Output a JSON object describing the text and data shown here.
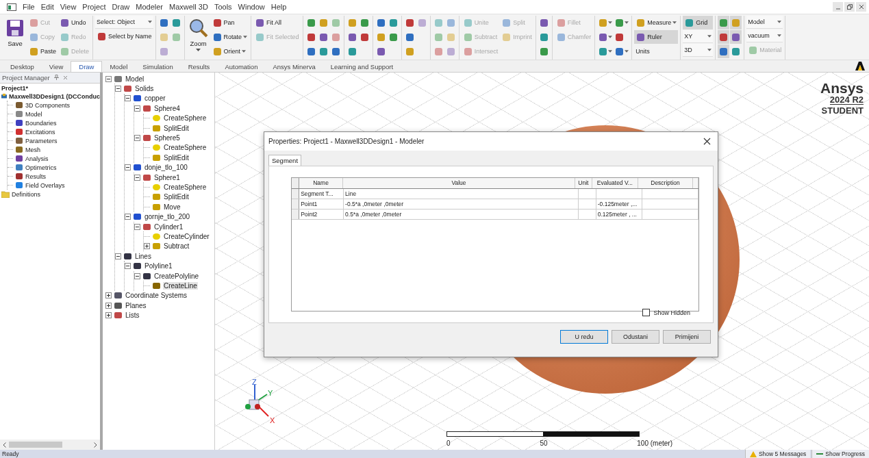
{
  "menu": [
    "File",
    "Edit",
    "View",
    "Project",
    "Draw",
    "Modeler",
    "Maxwell 3D",
    "Tools",
    "Window",
    "Help"
  ],
  "ribbon": {
    "groups": [
      {
        "columns": [
          [
            {
              "kind": "large",
              "label": "Save",
              "disabled": false
            }
          ],
          [
            {
              "kind": "small",
              "label": "Cut",
              "disabled": true
            },
            {
              "kind": "small",
              "label": "Copy",
              "disabled": true
            },
            {
              "kind": "small",
              "label": "Paste",
              "disabled": false
            }
          ],
          [
            {
              "kind": "small",
              "label": "Undo",
              "disabled": false
            },
            {
              "kind": "small",
              "label": "Redo",
              "disabled": true
            },
            {
              "kind": "small",
              "label": "Delete",
              "disabled": true
            }
          ]
        ]
      },
      {
        "columns": [
          [
            {
              "kind": "select",
              "label": "Select: Object"
            },
            {
              "kind": "small",
              "label": "Select by Name",
              "disabled": false
            }
          ]
        ]
      },
      {
        "columns": [
          [
            {
              "kind": "icon",
              "disabled": false
            },
            {
              "kind": "icon",
              "disabled": true
            },
            {
              "kind": "icon",
              "disabled": true
            }
          ],
          [
            {
              "kind": "icon",
              "disabled": false
            },
            {
              "kind": "icon",
              "disabled": true
            }
          ]
        ]
      },
      {
        "columns": [
          [
            {
              "kind": "large",
              "label": "Zoom",
              "disabled": false,
              "menu": true
            }
          ],
          [
            {
              "kind": "small",
              "label": "Pan",
              "disabled": false
            },
            {
              "kind": "small",
              "label": "Rotate",
              "disabled": false,
              "menu": true
            },
            {
              "kind": "small",
              "label": "Orient",
              "disabled": false,
              "menu": true
            }
          ]
        ]
      },
      {
        "columns": [
          [
            {
              "kind": "small",
              "label": "Fit All",
              "disabled": false
            },
            {
              "kind": "small",
              "label": "Fit Selected",
              "disabled": true
            }
          ]
        ]
      },
      {
        "columns": [
          [
            {
              "kind": "icon",
              "disabled": false
            },
            {
              "kind": "icon",
              "disabled": false
            },
            {
              "kind": "icon",
              "disabled": false
            }
          ],
          [
            {
              "kind": "icon",
              "disabled": false
            },
            {
              "kind": "icon",
              "disabled": false
            },
            {
              "kind": "icon",
              "disabled": false
            }
          ],
          [
            {
              "kind": "icon",
              "disabled": true
            },
            {
              "kind": "icon",
              "disabled": true
            },
            {
              "kind": "icon",
              "disabled": false
            }
          ]
        ]
      },
      {
        "columns": [
          [
            {
              "kind": "icon",
              "disabled": false
            },
            {
              "kind": "icon",
              "disabled": false
            },
            {
              "kind": "icon",
              "disabled": false
            }
          ],
          [
            {
              "kind": "icon",
              "disabled": false
            },
            {
              "kind": "icon",
              "disabled": false
            }
          ]
        ]
      },
      {
        "columns": [
          [
            {
              "kind": "icon",
              "disabled": false
            },
            {
              "kind": "icon",
              "disabled": false
            },
            {
              "kind": "icon",
              "disabled": false
            }
          ],
          [
            {
              "kind": "icon",
              "disabled": false
            },
            {
              "kind": "icon",
              "disabled": false
            }
          ]
        ]
      },
      {
        "columns": [
          [
            {
              "kind": "icon",
              "disabled": false
            },
            {
              "kind": "icon",
              "disabled": false
            },
            {
              "kind": "icon",
              "disabled": false
            }
          ],
          [
            {
              "kind": "icon",
              "disabled": true
            }
          ]
        ]
      },
      {
        "columns": [
          [
            {
              "kind": "icon",
              "disabled": true
            },
            {
              "kind": "icon",
              "disabled": true
            },
            {
              "kind": "icon",
              "disabled": true
            }
          ],
          [
            {
              "kind": "icon",
              "disabled": true
            },
            {
              "kind": "icon",
              "disabled": true
            },
            {
              "kind": "icon",
              "disabled": true
            }
          ]
        ]
      },
      {
        "columns": [
          [
            {
              "kind": "small",
              "label": "Unite",
              "disabled": true
            },
            {
              "kind": "small",
              "label": "Subtract",
              "disabled": true
            },
            {
              "kind": "small",
              "label": "Intersect",
              "disabled": true
            }
          ],
          [
            {
              "kind": "small",
              "label": "Split",
              "disabled": true
            },
            {
              "kind": "small",
              "label": "Imprint",
              "disabled": true
            }
          ]
        ]
      },
      {
        "columns": [
          [
            {
              "kind": "icon",
              "disabled": false
            },
            {
              "kind": "icon",
              "disabled": false
            },
            {
              "kind": "icon",
              "disabled": false
            }
          ]
        ]
      },
      {
        "columns": [
          [
            {
              "kind": "small",
              "label": "Fillet",
              "disabled": true
            },
            {
              "kind": "small",
              "label": "Chamfer",
              "disabled": true
            }
          ]
        ]
      },
      {
        "columns": [
          [
            {
              "kind": "icon",
              "disabled": false,
              "menu": true
            },
            {
              "kind": "icon",
              "disabled": false,
              "menu": true
            },
            {
              "kind": "icon",
              "disabled": false,
              "menu": true
            }
          ],
          [
            {
              "kind": "icon",
              "disabled": false,
              "menu": true
            },
            {
              "kind": "icon",
              "disabled": false
            },
            {
              "kind": "icon",
              "disabled": false,
              "menu": true
            }
          ]
        ]
      },
      {
        "columns": [
          [
            {
              "kind": "small",
              "label": "Measure",
              "disabled": false,
              "menu": true,
              "on": false
            },
            {
              "kind": "small",
              "label": "Ruler",
              "disabled": false,
              "on": true
            },
            {
              "kind": "plain",
              "label": "Units",
              "disabled": false
            }
          ]
        ]
      },
      {
        "columns": [
          [
            {
              "kind": "small",
              "label": "Grid",
              "disabled": false,
              "on": true
            },
            {
              "kind": "select",
              "label": "XY"
            },
            {
              "kind": "select",
              "label": "3D"
            }
          ]
        ]
      },
      {
        "columns": [
          [
            {
              "kind": "icon",
              "disabled": false,
              "on": true
            },
            {
              "kind": "icon",
              "disabled": false,
              "on": true
            },
            {
              "kind": "icon",
              "disabled": false,
              "on": true
            }
          ],
          [
            {
              "kind": "icon",
              "disabled": false,
              "on": true
            },
            {
              "kind": "icon",
              "disabled": false,
              "on": true
            },
            {
              "kind": "icon",
              "disabled": false,
              "on": false
            }
          ]
        ]
      },
      {
        "columns": [
          [
            {
              "kind": "select",
              "label": "Model"
            },
            {
              "kind": "select",
              "label": "vacuum"
            },
            {
              "kind": "small",
              "label": "Material",
              "disabled": true
            }
          ]
        ]
      }
    ]
  },
  "tabs": [
    {
      "label": "Desktop",
      "selected": false
    },
    {
      "label": "View",
      "selected": false
    },
    {
      "label": "Draw",
      "selected": true
    },
    {
      "label": "Model",
      "selected": false
    },
    {
      "label": "Simulation",
      "selected": false
    },
    {
      "label": "Results",
      "selected": false
    },
    {
      "label": "Automation",
      "selected": false
    },
    {
      "label": "Ansys Minerva",
      "selected": false
    },
    {
      "label": "Learning and Support",
      "selected": false
    }
  ],
  "project_manager": {
    "title": "Project Manager",
    "project": "Project1*",
    "design": "Maxwell3DDesign1 (DCConduc",
    "items": [
      {
        "kind": "components",
        "label": "3D Components"
      },
      {
        "kind": "model",
        "label": "Model"
      },
      {
        "kind": "boundaries",
        "label": "Boundaries"
      },
      {
        "kind": "excitations",
        "label": "Excitations"
      },
      {
        "kind": "parameters",
        "label": "Parameters"
      },
      {
        "kind": "mesh",
        "label": "Mesh"
      },
      {
        "kind": "analysis",
        "label": "Analysis"
      },
      {
        "kind": "optimetrics",
        "label": "Optimetrics"
      },
      {
        "kind": "results",
        "label": "Results"
      },
      {
        "kind": "overlays",
        "label": "Field Overlays"
      }
    ],
    "definitions": "Definitions"
  },
  "model_tree": [
    {
      "kind": "model",
      "label": "Model",
      "expanded": true,
      "children": [
        {
          "kind": "group",
          "label": "Solids",
          "expanded": true,
          "children": [
            {
              "kind": "material",
              "label": "copper",
              "expanded": true,
              "children": [
                {
                  "kind": "solid",
                  "label": "Sphere4",
                  "expanded": true,
                  "children": [
                    {
                      "kind": "create",
                      "label": "CreateSphere"
                    },
                    {
                      "kind": "split",
                      "label": "SplitEdit"
                    }
                  ]
                },
                {
                  "kind": "solid",
                  "label": "Sphere5",
                  "expanded": true,
                  "children": [
                    {
                      "kind": "create",
                      "label": "CreateSphere"
                    },
                    {
                      "kind": "split",
                      "label": "SplitEdit"
                    }
                  ]
                }
              ]
            },
            {
              "kind": "material",
              "label": "donje_tlo_100",
              "expanded": true,
              "children": [
                {
                  "kind": "solid",
                  "label": "Sphere1",
                  "expanded": true,
                  "children": [
                    {
                      "kind": "create",
                      "label": "CreateSphere"
                    },
                    {
                      "kind": "split",
                      "label": "SplitEdit"
                    },
                    {
                      "kind": "move",
                      "label": "Move"
                    }
                  ]
                }
              ]
            },
            {
              "kind": "material",
              "label": "gornje_tlo_200",
              "expanded": true,
              "children": [
                {
                  "kind": "solid",
                  "label": "Cylinder1",
                  "expanded": true,
                  "children": [
                    {
                      "kind": "cylinder",
                      "label": "CreateCylinder"
                    },
                    {
                      "kind": "subtract",
                      "label": "Subtract",
                      "expanded": false
                    }
                  ]
                }
              ]
            }
          ]
        },
        {
          "kind": "line",
          "label": "Lines",
          "expanded": true,
          "children": [
            {
              "kind": "line",
              "label": "Polyline1",
              "expanded": true,
              "children": [
                {
                  "kind": "line",
                  "label": "CreatePolyline",
                  "expanded": true,
                  "children": [
                    {
                      "kind": "segment",
                      "label": "CreateLine",
                      "selected": true
                    }
                  ]
                }
              ]
            }
          ]
        }
      ]
    },
    {
      "kind": "coords",
      "label": "Coordinate Systems",
      "expanded": false
    },
    {
      "kind": "planes",
      "label": "Planes",
      "expanded": false
    },
    {
      "kind": "lists",
      "label": "Lists",
      "expanded": false
    }
  ],
  "viewport": {
    "logo": "Ansys",
    "version": "2024 R2",
    "edition": "STUDENT",
    "scale_labels": [
      "0",
      "50",
      "100 (meter)"
    ],
    "axes": [
      "Z",
      "Y",
      "X"
    ]
  },
  "dialog": {
    "title": "Properties: Project1 - Maxwell3DDesign1 - Modeler",
    "tab": "Segment",
    "columns": [
      "Name",
      "Value",
      "Unit",
      "Evaluated V...",
      "Description"
    ],
    "rows": [
      {
        "name": "Segment T...",
        "value": "Line"
      },
      {
        "name": "Point1",
        "value": "-0.5*a ,0meter ,0meter",
        "evaluated": "-0.125meter ,..."
      },
      {
        "name": "Point2",
        "value": "0.5*a ,0meter ,0meter",
        "evaluated": "0.125meter , ..."
      }
    ],
    "show_hidden": {
      "label": "Show Hidden",
      "checked": false
    },
    "buttons": [
      "U redu",
      "Odustani",
      "Primijeni"
    ]
  },
  "status_bar": {
    "text": "Ready",
    "messages": "Show 5 Messages",
    "progress": "Show Progress"
  }
}
